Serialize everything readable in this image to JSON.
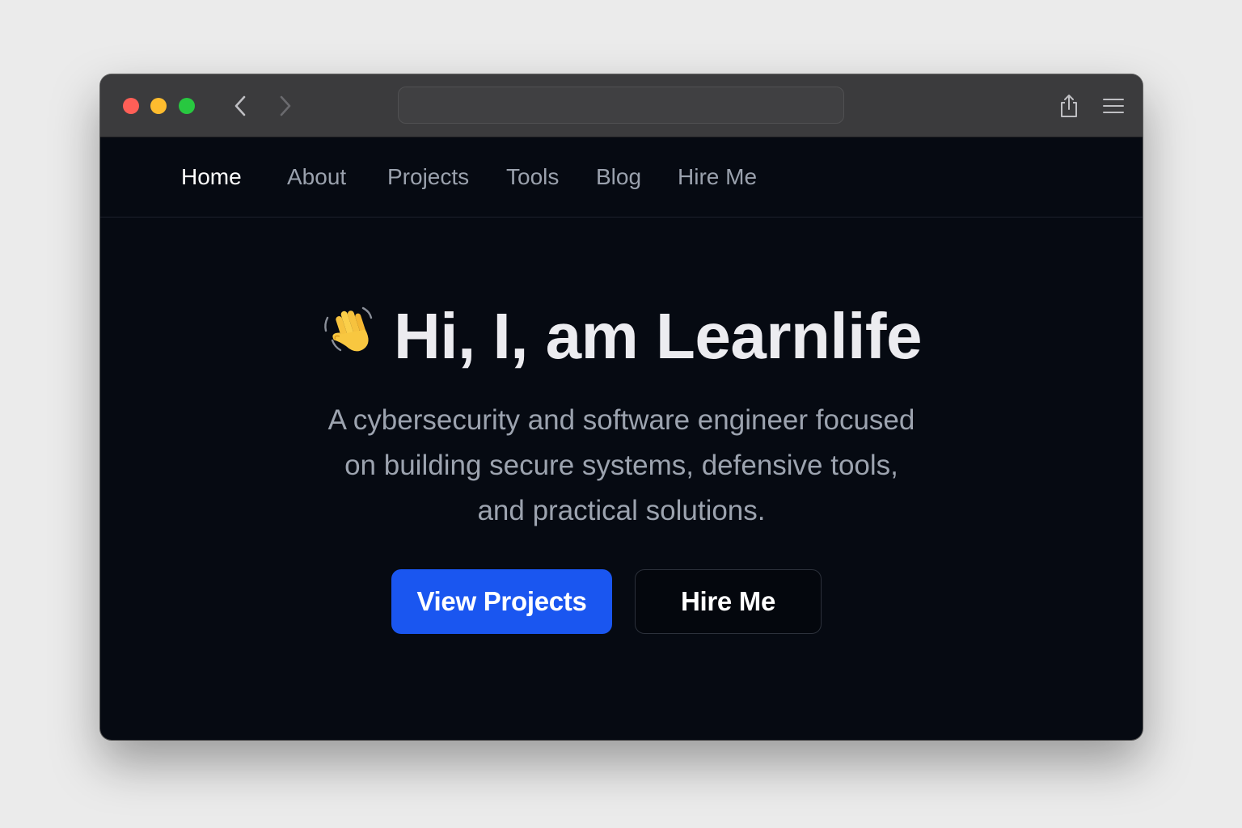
{
  "browser": {
    "traffic_lights": [
      {
        "name": "close",
        "color": "#ff5f57"
      },
      {
        "name": "minimize",
        "color": "#febc2e"
      },
      {
        "name": "maximize",
        "color": "#28c840"
      }
    ],
    "address_bar_value": "",
    "icons": {
      "back": "chevron-left-icon",
      "forward": "chevron-right-icon",
      "share": "share-icon",
      "menu": "hamburger-menu-icon"
    }
  },
  "nav": {
    "items": [
      {
        "label": "Home",
        "active": true
      },
      {
        "label": "About",
        "active": false
      },
      {
        "label": "Projects",
        "active": false
      },
      {
        "label": "Tools",
        "active": false
      },
      {
        "label": "Blog",
        "active": false
      },
      {
        "label": "Hire Me",
        "active": false
      }
    ]
  },
  "hero": {
    "emoji_icon": "waving-hand-icon",
    "title": "Hi, I, am Learnlife",
    "subtitle_lines": [
      "A cybersecurity and software engineer focused",
      "on building secure systems, defensive tools,",
      "and practical solutions."
    ],
    "primary_button": "View Projects",
    "secondary_button": "Hire Me"
  },
  "colors": {
    "page_background": "#060a12",
    "accent": "#1a56f0",
    "title_bar": "#3b3b3d"
  }
}
